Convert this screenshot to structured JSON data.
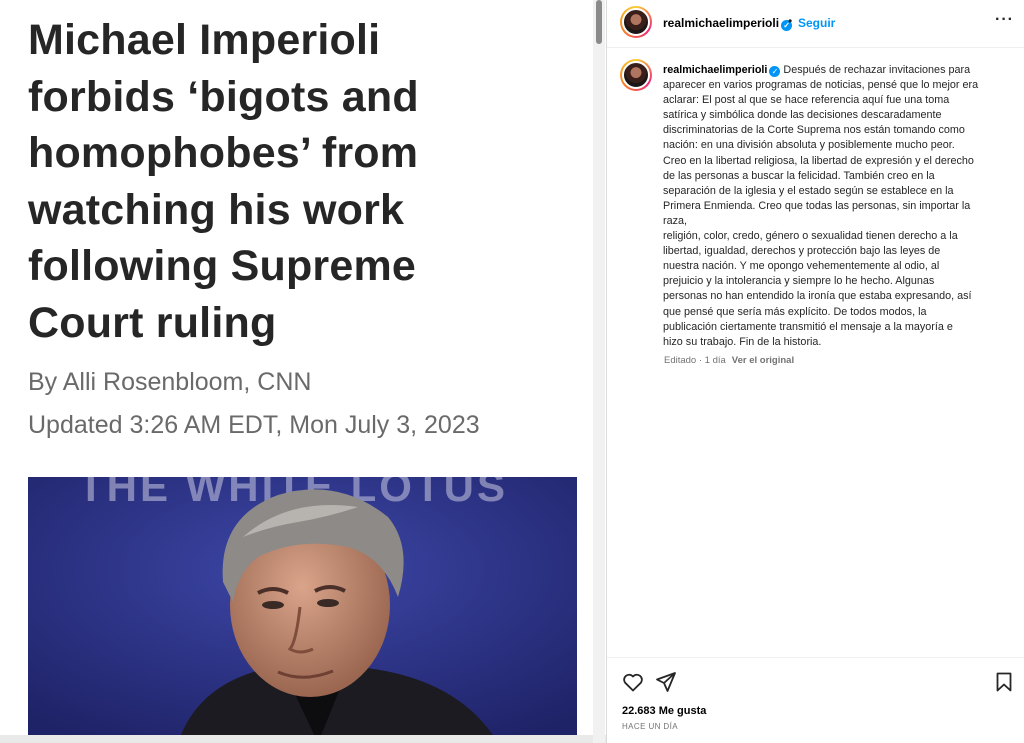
{
  "article": {
    "headline_lines": [
      "Michael Imperioli",
      "forbids ‘bigots and",
      "homophobes’ from",
      "watching his work",
      "following Supreme",
      "Court ruling"
    ],
    "byline": "By Alli Rosenbloom, CNN",
    "updated": "Updated 3:26 AM EDT, Mon July 3, 2023",
    "photo_backdrop_text": "THE WHITE LOTUS"
  },
  "post": {
    "username": "realmichaelimperioli",
    "verified_icon": "verified-badge-icon",
    "follow_label": "Seguir",
    "more_icon": "more-options-icon",
    "caption_lines": [
      "Después de rechazar invitaciones para",
      "aparecer en varios programas de noticias, pensé que lo mejor era",
      "aclarar: El post al que se hace referencia aquí fue una toma",
      "satírica y simbólica donde las decisiones descaradamente",
      "discriminatorias de la Corte Suprema nos están tomando como",
      "nación: en una división absoluta y posiblemente mucho peor.",
      "Creo en la libertad religiosa, la libertad de expresión y el derecho",
      "de las personas a buscar la felicidad. También creo en la",
      "separación de la iglesia y el estado según se establece en la",
      "Primera Enmienda. Creo que todas las personas, sin importar la",
      "raza,",
      "religión, color, credo, género o sexualidad tienen derecho a la",
      "libertad, igualdad, derechos y protección bajo las leyes de",
      "nuestra nación. Y me opongo vehementemente al odio, al",
      "prejuicio y la intolerancia y siempre lo he hecho. Algunas",
      "personas no han entendido la ironía que estaba expresando, así",
      "que pensé que sería más explícito. De todos modos, la",
      "publicación ciertamente transmitió el mensaje a la mayoría e",
      "hizo su trabajo. Fin de la historia."
    ],
    "edited_meta": "Editado · 1 día",
    "see_original": "Ver el original",
    "likes": "22.683 Me gusta",
    "timestamp": "HACE UN DÍA",
    "accent_color": "#0095f6"
  }
}
